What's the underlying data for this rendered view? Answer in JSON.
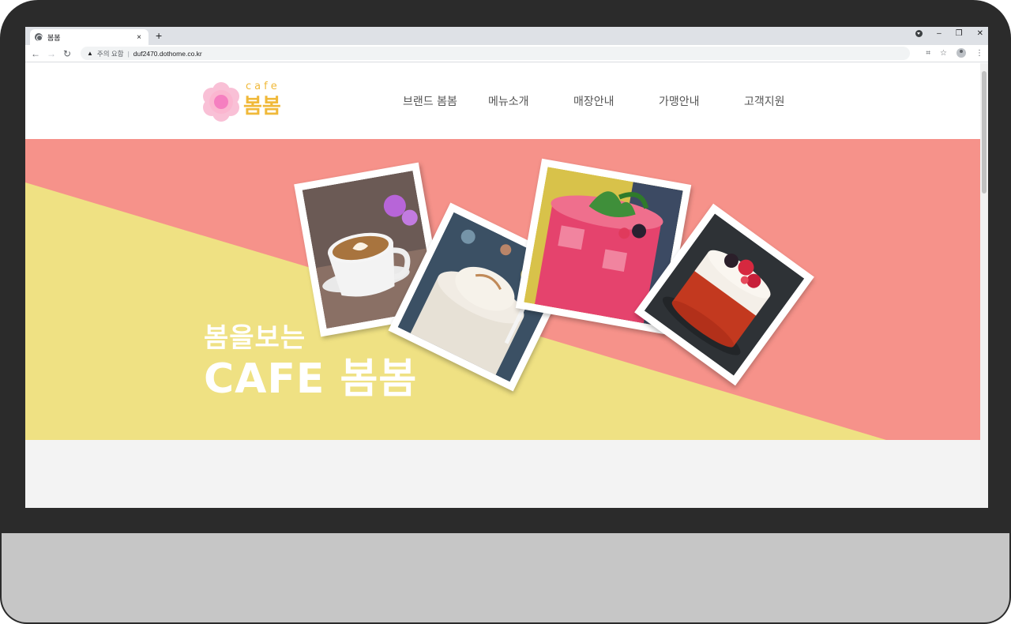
{
  "browser": {
    "tab_title": "봄봄",
    "tab_close": "×",
    "new_tab": "+",
    "security_label": "주의 요함",
    "url": "duf2470.dothome.co.kr",
    "nav": {
      "back": "←",
      "forward": "→",
      "reload": "↻"
    },
    "window": {
      "minimize": "–",
      "restore": "❐",
      "close": "✕"
    },
    "toolbar_icons": {
      "extensions": "⌗",
      "bookmark": "☆",
      "menu": "⋮"
    }
  },
  "site": {
    "logo": {
      "small": "cafe",
      "name": "봄봄"
    },
    "menu": [
      "브랜드 봄봄",
      "메뉴소개",
      "매장안내",
      "가맹안내",
      "고객지원"
    ],
    "hero": {
      "subtitle": "봄을보는",
      "title": "CAFE 봄봄"
    },
    "colors": {
      "hero_pink": "#f6928a",
      "hero_yellow": "#efe183",
      "logo_gold": "#f0b93a",
      "logo_pink": "#f7a8c8"
    }
  },
  "photos": [
    "latte-photo",
    "ice-cream-photo",
    "pink-drink-photo",
    "cake-photo"
  ]
}
